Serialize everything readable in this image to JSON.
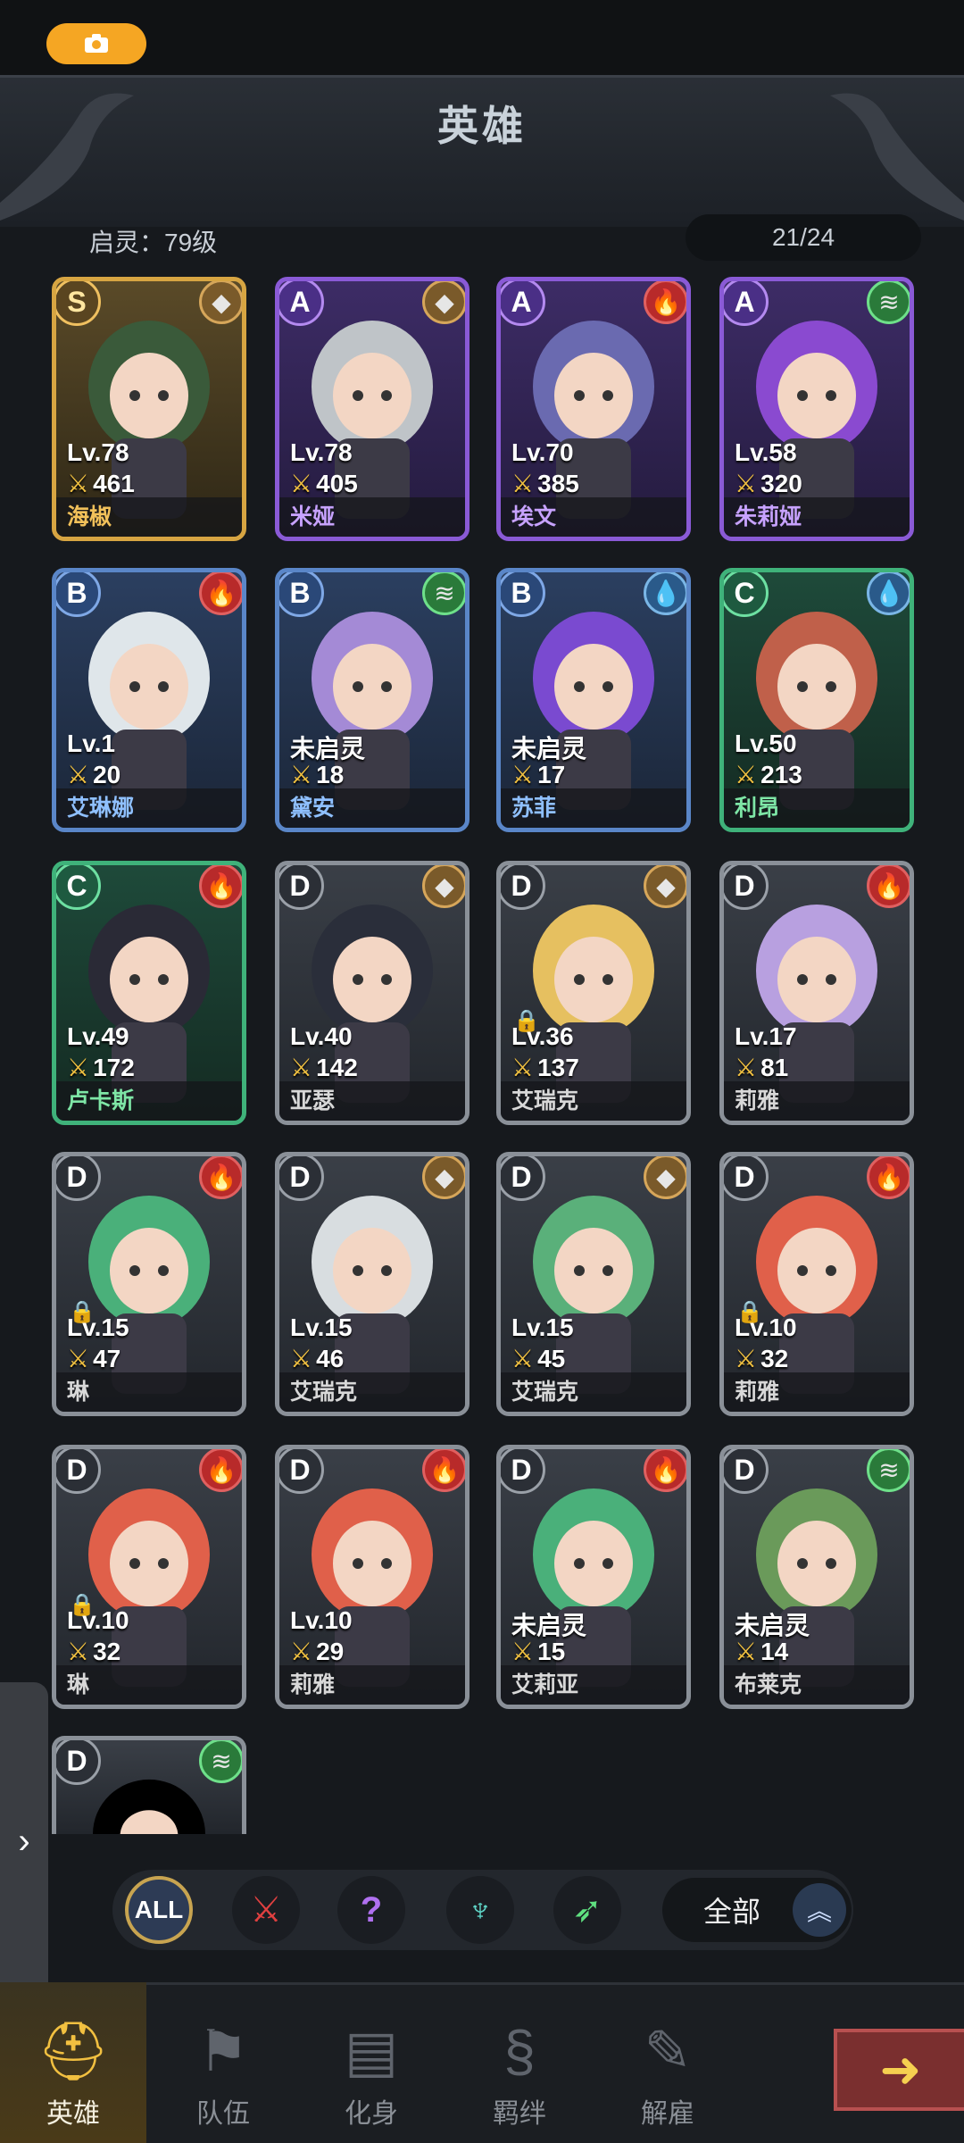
{
  "header": {
    "title": "英雄",
    "qiling_label": "启灵：79级",
    "roster_count": "21/24"
  },
  "cards": [
    {
      "rarity": "S",
      "element": "earth",
      "level": "Lv.78",
      "power": "461",
      "name": "海椒",
      "locked": false
    },
    {
      "rarity": "A",
      "element": "earth",
      "level": "Lv.78",
      "power": "405",
      "name": "米娅",
      "locked": false
    },
    {
      "rarity": "A",
      "element": "fire",
      "level": "Lv.70",
      "power": "385",
      "name": "埃文",
      "locked": false
    },
    {
      "rarity": "A",
      "element": "wind",
      "level": "Lv.58",
      "power": "320",
      "name": "朱莉娅",
      "locked": false
    },
    {
      "rarity": "B",
      "element": "fire",
      "level": "Lv.1",
      "power": "20",
      "name": "艾琳娜",
      "locked": false
    },
    {
      "rarity": "B",
      "element": "wind",
      "level": "未启灵",
      "power": "18",
      "name": "黛安",
      "locked": false
    },
    {
      "rarity": "B",
      "element": "water",
      "level": "未启灵",
      "power": "17",
      "name": "苏菲",
      "locked": false
    },
    {
      "rarity": "C",
      "element": "water",
      "level": "Lv.50",
      "power": "213",
      "name": "利昂",
      "locked": false
    },
    {
      "rarity": "C",
      "element": "fire",
      "level": "Lv.49",
      "power": "172",
      "name": "卢卡斯",
      "locked": false
    },
    {
      "rarity": "D",
      "element": "earth",
      "level": "Lv.40",
      "power": "142",
      "name": "亚瑟",
      "locked": false
    },
    {
      "rarity": "D",
      "element": "earth",
      "level": "Lv.36",
      "power": "137",
      "name": "艾瑞克",
      "locked": true
    },
    {
      "rarity": "D",
      "element": "fire",
      "level": "Lv.17",
      "power": "81",
      "name": "莉雅",
      "locked": false
    },
    {
      "rarity": "D",
      "element": "fire",
      "level": "Lv.15",
      "power": "47",
      "name": "琳",
      "locked": true
    },
    {
      "rarity": "D",
      "element": "earth",
      "level": "Lv.15",
      "power": "46",
      "name": "艾瑞克",
      "locked": false
    },
    {
      "rarity": "D",
      "element": "earth",
      "level": "Lv.15",
      "power": "45",
      "name": "艾瑞克",
      "locked": false
    },
    {
      "rarity": "D",
      "element": "fire",
      "level": "Lv.10",
      "power": "32",
      "name": "莉雅",
      "locked": true
    },
    {
      "rarity": "D",
      "element": "fire",
      "level": "Lv.10",
      "power": "32",
      "name": "琳",
      "locked": true
    },
    {
      "rarity": "D",
      "element": "fire",
      "level": "Lv.10",
      "power": "29",
      "name": "莉雅",
      "locked": false
    },
    {
      "rarity": "D",
      "element": "fire",
      "level": "未启灵",
      "power": "15",
      "name": "艾莉亚",
      "locked": false
    },
    {
      "rarity": "D",
      "element": "wind",
      "level": "未启灵",
      "power": "14",
      "name": "布莱克",
      "locked": false
    }
  ],
  "partial_card": {
    "rarity": "D",
    "element": "wind"
  },
  "filters": {
    "all_label": "ALL",
    "dropdown_label": "全部",
    "icons": [
      "warrior-class-icon",
      "mystery-class-icon",
      "mage-class-icon",
      "archer-class-icon"
    ]
  },
  "nav": [
    {
      "label": "英雄",
      "icon": "helmet-icon",
      "active": true
    },
    {
      "label": "队伍",
      "icon": "banner-icon",
      "active": false
    },
    {
      "label": "化身",
      "icon": "cards-icon",
      "active": false
    },
    {
      "label": "羁绊",
      "icon": "scroll-icon",
      "active": false
    },
    {
      "label": "解雇",
      "icon": "dismiss-icon",
      "active": false
    }
  ],
  "colors": {
    "accent": "#f5a623",
    "background": "#16191d"
  }
}
